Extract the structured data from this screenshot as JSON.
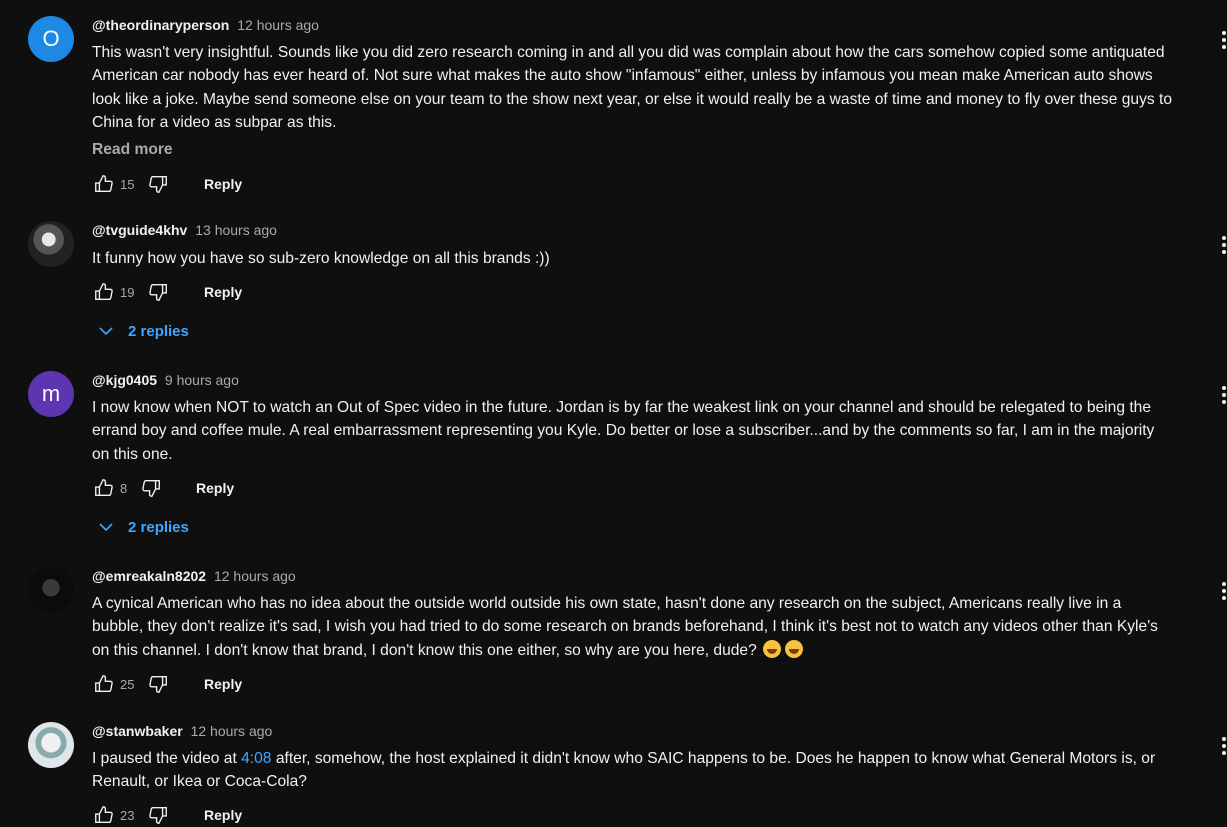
{
  "comments": [
    {
      "avatar_letter": "O",
      "author": "@theordinaryperson",
      "time": "12 hours ago",
      "text_lines": [
        "This wasn't very insightful. Sounds like you did zero research coming in and all you did was complain about how the cars somehow copied some antiquated",
        "American car nobody has ever heard of. Not sure what makes the auto show \"infamous\" either, unless by infamous you mean make American auto shows",
        "look like a joke. Maybe send someone else on your team to the show next year, or else it would really be a waste of time and money to fly over these guys to",
        "China for a video as subpar as this."
      ],
      "read_more": "Read more",
      "likes": "15",
      "reply_label": "Reply"
    },
    {
      "author": "@tvguide4khv",
      "time": "13 hours ago",
      "text_lines": [
        "It funny how you have so sub-zero knowledge on all this brands :))"
      ],
      "likes": "19",
      "reply_label": "Reply",
      "replies_label": "2 replies"
    },
    {
      "avatar_letter": "m",
      "author": "@kjg0405",
      "time": "9 hours ago",
      "text_lines": [
        "I now know when NOT to watch an Out of Spec video in the future.  Jordan is by far the weakest link on your channel and should be relegated to being the",
        "errand boy and coffee mule.  A real embarrassment representing you Kyle.  Do better or lose a subscriber...and by the comments so far, I am in the majority",
        "on this one."
      ],
      "likes": "8",
      "reply_label": "Reply",
      "replies_label": "2 replies"
    },
    {
      "author": "@emreakaln8202",
      "time": "12 hours ago",
      "text_lines": [
        "A cynical American who has no idea about the outside world outside his own state, hasn't done any research on the subject, Americans really live in a",
        "bubble, they don't realize it's sad, I wish you had tried to do some research on brands beforehand, I think it's best not to watch any videos other than Kyle's",
        "on this channel.    I don't know that brand, I don't know this one either, so why are you here, dude?"
      ],
      "likes": "25",
      "reply_label": "Reply"
    },
    {
      "author": "@stanwbaker",
      "time": "12 hours ago",
      "text_before_link": "I paused the video at ",
      "timestamp_link": "4:08",
      "text_after_link": " after, somehow, the host explained it didn't know who SAIC happens to be.  Does he happen to know what General Motors is, or",
      "text_line2": "Renault, or Ikea or Coca-Cola?",
      "likes": "23",
      "reply_label": "Reply"
    }
  ]
}
